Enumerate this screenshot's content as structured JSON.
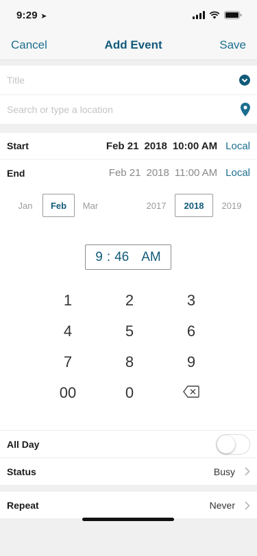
{
  "status_bar": {
    "time": "9:29"
  },
  "nav": {
    "cancel": "Cancel",
    "title": "Add Event",
    "save": "Save"
  },
  "form": {
    "title_placeholder": "Title",
    "location_placeholder": "Search or type a location"
  },
  "start": {
    "label": "Start",
    "date": "Feb 21",
    "year": "2018",
    "time": "10:00 AM",
    "timezone": "Local"
  },
  "end": {
    "label": "End",
    "date": "Feb 21",
    "year": "2018",
    "time": "11:00 AM",
    "timezone": "Local"
  },
  "month_picker": {
    "prev": "Jan",
    "selected": "Feb",
    "next": "Mar"
  },
  "year_picker": {
    "prev": "2017",
    "selected": "2018",
    "next": "2019"
  },
  "time_entry": {
    "hour": "9",
    "sep": ":",
    "minute": "46",
    "period": "AM"
  },
  "keypad": {
    "rows": [
      [
        "1",
        "2",
        "3"
      ],
      [
        "4",
        "5",
        "6"
      ],
      [
        "7",
        "8",
        "9"
      ],
      [
        "00",
        "0",
        "backspace"
      ]
    ]
  },
  "settings": {
    "all_day": {
      "label": "All Day",
      "on": false
    },
    "status": {
      "label": "Status",
      "value": "Busy"
    },
    "repeat": {
      "label": "Repeat",
      "value": "Never"
    }
  },
  "colors": {
    "accent": "#1b6e8f",
    "title": "#125a7a"
  }
}
